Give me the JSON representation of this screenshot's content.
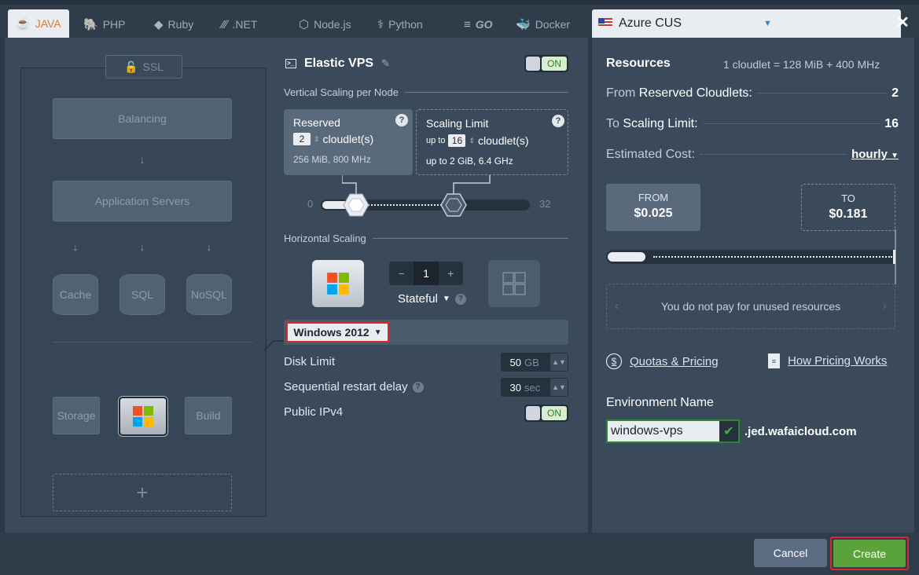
{
  "tabs": [
    {
      "label": "JAVA",
      "icon": "java-icon",
      "active": true
    },
    {
      "label": "PHP",
      "icon": "php-icon"
    },
    {
      "label": "Ruby",
      "icon": "ruby-icon"
    },
    {
      "label": ".NET",
      "icon": "dotnet-icon"
    },
    {
      "label": "Node.js",
      "icon": "nodejs-icon"
    },
    {
      "label": "Python",
      "icon": "python-icon"
    },
    {
      "label": "GO",
      "icon": "go-icon"
    },
    {
      "label": "Docker",
      "icon": "docker-icon"
    }
  ],
  "topology": {
    "ssl": "SSL",
    "balancing": "Balancing",
    "app_servers": "Application Servers",
    "cache": "Cache",
    "sql": "SQL",
    "nosql": "NoSQL",
    "storage": "Storage",
    "build": "Build",
    "add": "+"
  },
  "node": {
    "title": "Elastic VPS",
    "toggle": "ON",
    "vertical_label": "Vertical Scaling per Node",
    "reserved": {
      "title": "Reserved",
      "value": "2",
      "unit": "cloudlet(s)",
      "detail": "256 MiB, 800 MHz"
    },
    "limit": {
      "title": "Scaling Limit",
      "prefix": "up to",
      "value": "16",
      "unit": "cloudlet(s)",
      "detail_prefix": "up to ",
      "detail": "2 GiB, 6.4 GHz"
    },
    "slider_min": "0",
    "slider_max": "32",
    "horizontal_label": "Horizontal Scaling",
    "count": "1",
    "minus": "−",
    "plus": "+",
    "mode": "Stateful",
    "os": "Windows 2012",
    "disk_label": "Disk Limit",
    "disk_value": "50",
    "disk_unit": "GB",
    "restart_label": "Sequential restart delay",
    "restart_value": "30",
    "restart_unit": "sec",
    "ipv4_label": "Public IPv4",
    "ipv4_toggle": "ON"
  },
  "region": {
    "name": "Azure CUS"
  },
  "resources": {
    "title": "Resources",
    "formula": "1 cloudlet = 128 MiB + 400 MHz",
    "from_prefix": "From",
    "from_label": "Reserved Cloudlets:",
    "from_value": "2",
    "to_prefix": "To",
    "to_label": "Scaling Limit:",
    "to_value": "16",
    "cost_label": "Estimated Cost:",
    "period": "hourly",
    "from_box_label": "FROM",
    "from_box_value": "$0.025",
    "to_box_label": "TO",
    "to_box_value": "$0.181",
    "unused_text": "You do not pay for unused resources",
    "quotas_link": "Quotas & Pricing",
    "how_link": "How Pricing Works"
  },
  "environment": {
    "label": "Environment Name",
    "value": "windows-vps",
    "domain": ".jed.wafaicloud.com"
  },
  "footer": {
    "cancel": "Cancel",
    "create": "Create"
  },
  "colors": {
    "accent_orange": "#e07a2e",
    "create_green": "#5aa33a",
    "highlight_red": "#d42a2a"
  }
}
